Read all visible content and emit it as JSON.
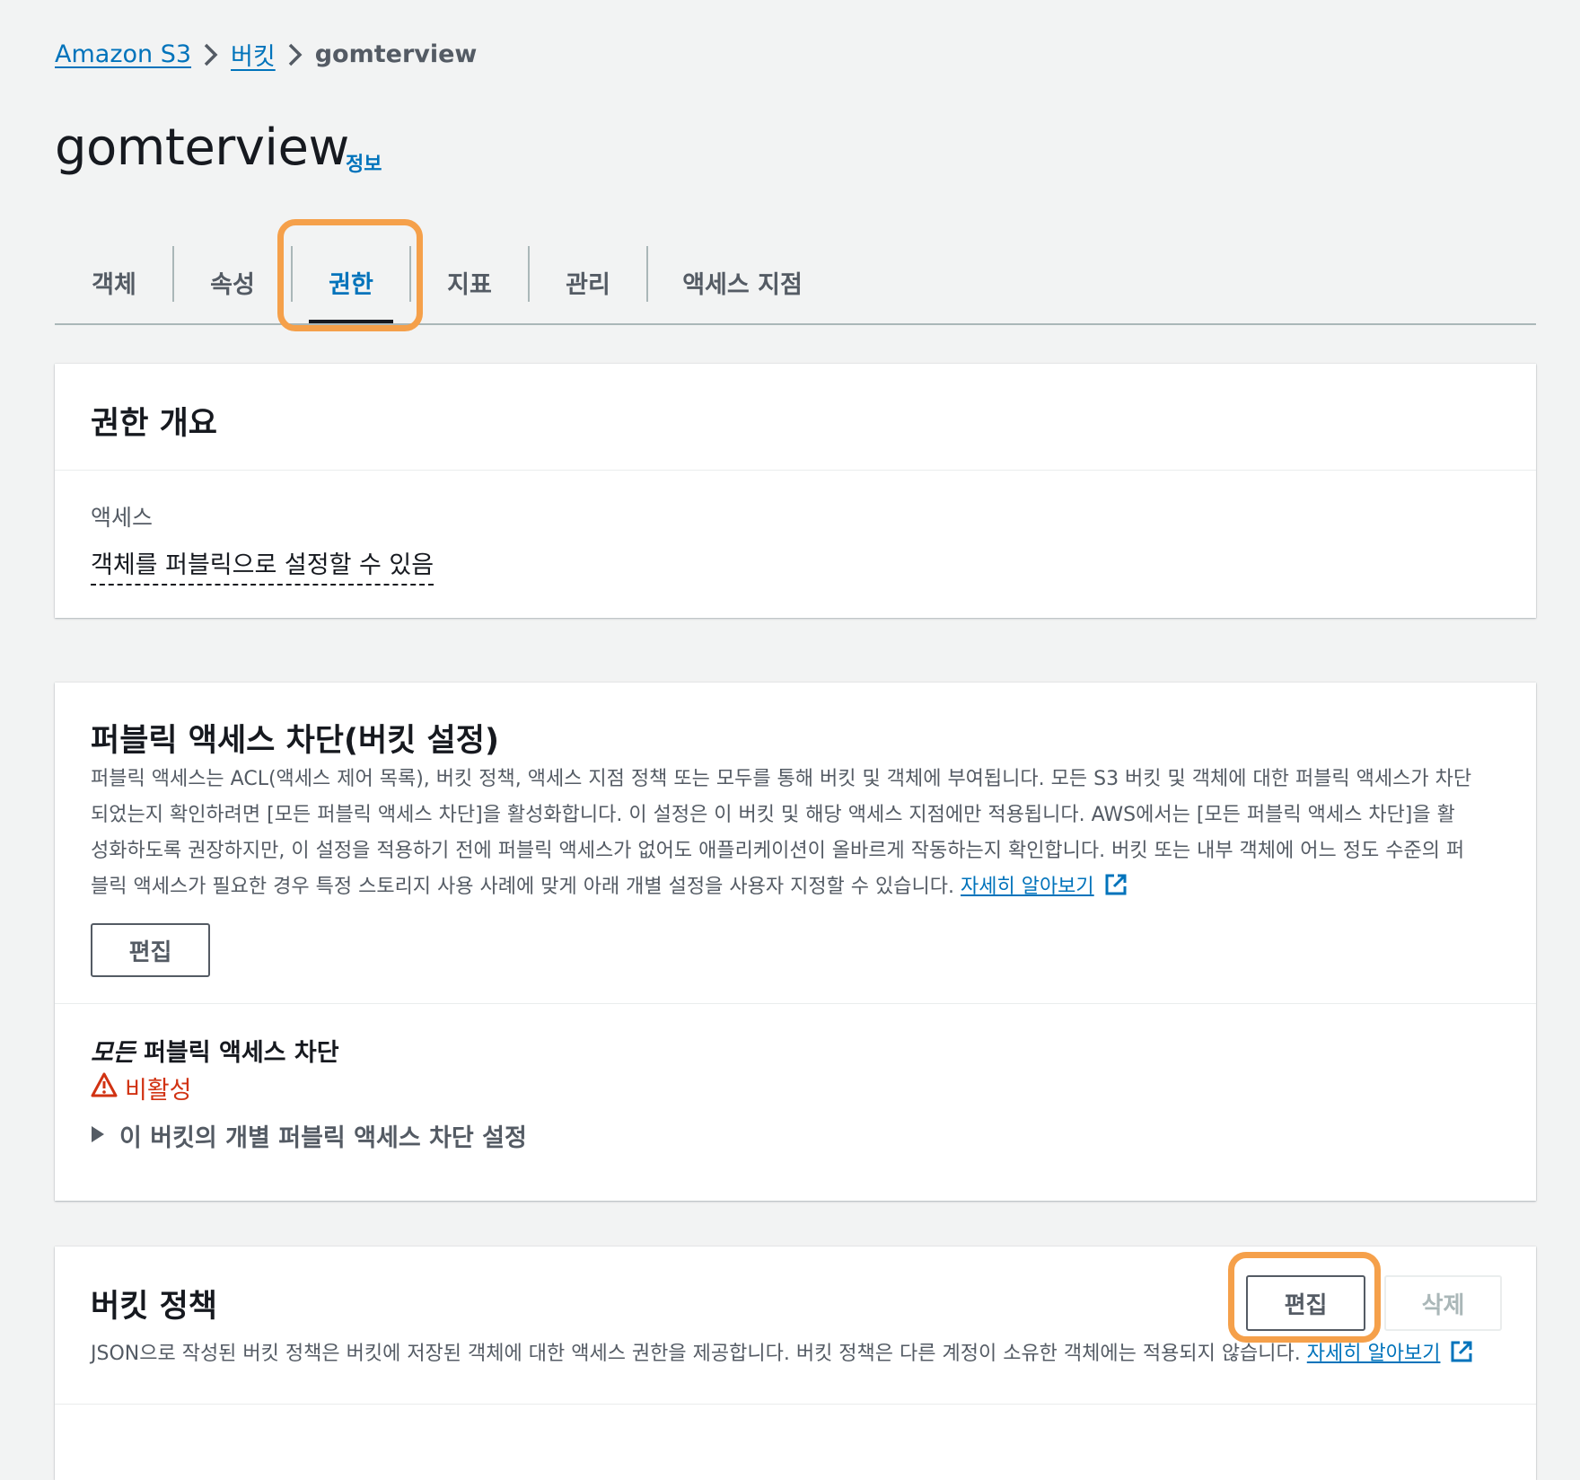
{
  "breadcrumb": {
    "items": [
      "Amazon S3",
      "버킷"
    ],
    "current": "gomterview"
  },
  "page": {
    "title": "gomterview",
    "info_label": "정보"
  },
  "tabs": [
    "객체",
    "속성",
    "권한",
    "지표",
    "관리",
    "액세스 지점"
  ],
  "active_tab": "권한",
  "permissions_overview": {
    "title": "권한 개요",
    "access_label": "액세스",
    "access_value": "객체를 퍼블릭으로 설정할 수 있음"
  },
  "block_public_access": {
    "title": "퍼블릭 액세스 차단(버킷 설정)",
    "description_lines": [
      "퍼블릭 액세스는 ACL(액세스 제어 목록), 버킷 정책, 액세스 지점 정책 또는 모두를 통해 버킷 및 객체에 부여됩니다. 모든 S3 버킷 및 객체에 대한 퍼블릭 액세스가 차단",
      "되었는지 확인하려면 [모든 퍼블릭 액세스 차단]을 활성화합니다. 이 설정은 이 버킷 및 해당 액세스 지점에만 적용됩니다. AWS에서는 [모든 퍼블릭 액세스 차단]을 활",
      "성화하도록 권장하지만, 이 설정을 적용하기 전에 퍼블릭 액세스가 없어도 애플리케이션이 올바르게 작동하는지 확인합니다. 버킷 또는 내부 객체에 어느 정도 수준의 퍼",
      "블릭 액세스가 필요한 경우 특정 스토리지 사용 사례에 맞게 아래 개별 설정을 사용자 지정할 수 있습니다."
    ],
    "learn_more": "자세히 알아보기",
    "edit_label": "편집",
    "setting_title_em": "모든",
    "setting_title_rest": " 퍼블릭 액세스 차단",
    "status": "비활성",
    "expander_label": "이 버킷의 개별 퍼블릭 액세스 차단 설정"
  },
  "bucket_policy": {
    "title": "버킷 정책",
    "description": "JSON으로 작성된 버킷 정책은 버킷에 저장된 객체에 대한 액세스 권한을 제공합니다. 버킷 정책은 다른 계정이 소유한 객체에는 적용되지 않습니다.",
    "learn_more": "자세히 알아보기",
    "edit_label": "편집",
    "delete_label": "삭제"
  },
  "colors": {
    "link": "#0073bb",
    "highlight": "#f5a04a",
    "error": "#d13212",
    "background": "#f2f3f3"
  }
}
